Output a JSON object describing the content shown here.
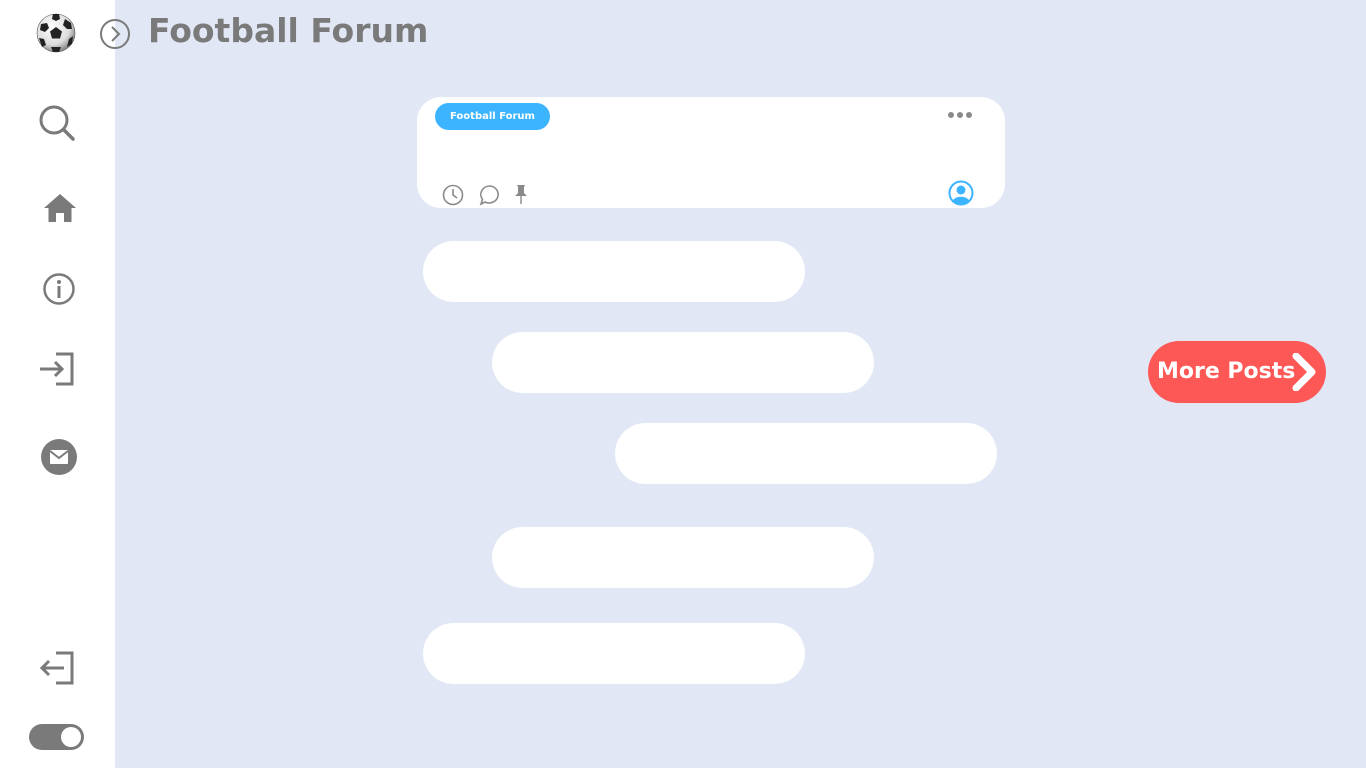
{
  "header": {
    "title": "Football Forum",
    "logo_icon": "soccer-ball-icon",
    "expand_icon": "chevron-right-circle-icon"
  },
  "sidebar": {
    "items": [
      {
        "name": "search",
        "icon": "search-icon"
      },
      {
        "name": "home",
        "icon": "home-icon"
      },
      {
        "name": "info",
        "icon": "info-icon"
      },
      {
        "name": "login",
        "icon": "login-icon"
      },
      {
        "name": "messages",
        "icon": "mail-icon"
      }
    ],
    "bottom_items": [
      {
        "name": "logout",
        "icon": "logout-icon"
      },
      {
        "name": "theme-toggle",
        "icon": "toggle-switch",
        "state": "on"
      }
    ]
  },
  "post_card": {
    "tag": "Football Forum",
    "menu_icon": "more-dots-icon",
    "footer_icons": [
      "clock-icon",
      "comment-icon",
      "pin-icon"
    ],
    "author_icon": "user-avatar-icon"
  },
  "more_posts": {
    "label": "More Posts",
    "icon": "chevron-right-icon"
  },
  "colors": {
    "background": "#e1e7f5",
    "sidebar": "#ffffff",
    "accent_blue": "#3db4ff",
    "accent_red": "#fd5756",
    "icon_gray": "#7a7a7a"
  }
}
